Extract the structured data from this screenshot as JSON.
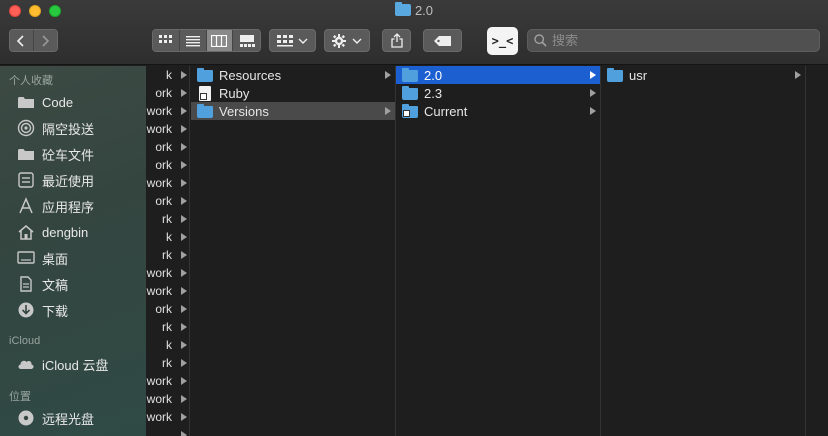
{
  "window": {
    "title": "2.0"
  },
  "toolbar": {
    "back_glyph": "<",
    "forward_glyph": ">",
    "terminal_label": ">_<",
    "search": {
      "placeholder": "搜索",
      "value": ""
    }
  },
  "sidebar": {
    "sections": [
      {
        "header": "个人收藏",
        "items": [
          {
            "label": "Code",
            "icon": "folder-icon"
          },
          {
            "label": "隔空投送",
            "icon": "airdrop-icon"
          },
          {
            "label": "砼车文件",
            "icon": "folder-icon"
          },
          {
            "label": "最近使用",
            "icon": "recents-icon"
          },
          {
            "label": "应用程序",
            "icon": "applications-icon"
          },
          {
            "label": "dengbin",
            "icon": "home-icon"
          },
          {
            "label": "桌面",
            "icon": "desktop-icon"
          },
          {
            "label": "文稿",
            "icon": "documents-icon"
          },
          {
            "label": "下载",
            "icon": "downloads-icon"
          }
        ]
      },
      {
        "header": "iCloud",
        "items": [
          {
            "label": "iCloud 云盘",
            "icon": "cloud-icon"
          }
        ]
      },
      {
        "header": "位置",
        "items": [
          {
            "label": "远程光盘",
            "icon": "disc-icon"
          }
        ]
      }
    ]
  },
  "column0": {
    "rows": [
      "k",
      "ork",
      "work",
      "work",
      "ork",
      "ork",
      "work",
      "ork",
      "rk",
      "k",
      "rk",
      "work",
      "work",
      "ork",
      "rk",
      "k",
      "rk",
      "work",
      "work",
      "work",
      ""
    ]
  },
  "column1": {
    "rows": [
      {
        "label": "Resources",
        "icon": "folder-icon",
        "state": "normal"
      },
      {
        "label": "Ruby",
        "icon": "alias-file-icon",
        "state": "normal"
      },
      {
        "label": "Versions",
        "icon": "folder-icon",
        "state": "path"
      }
    ]
  },
  "column2": {
    "rows": [
      {
        "label": "2.0",
        "icon": "folder-icon",
        "state": "selected"
      },
      {
        "label": "2.3",
        "icon": "folder-icon",
        "state": "normal"
      },
      {
        "label": "Current",
        "icon": "alias-folder-icon",
        "state": "normal"
      }
    ]
  },
  "column3": {
    "rows": [
      {
        "label": "usr",
        "icon": "folder-icon",
        "state": "normal"
      }
    ]
  },
  "colors": {
    "selection": "#1c5fd1",
    "path_highlight": "#4a4a4a",
    "folder": "#4fa0dc"
  }
}
